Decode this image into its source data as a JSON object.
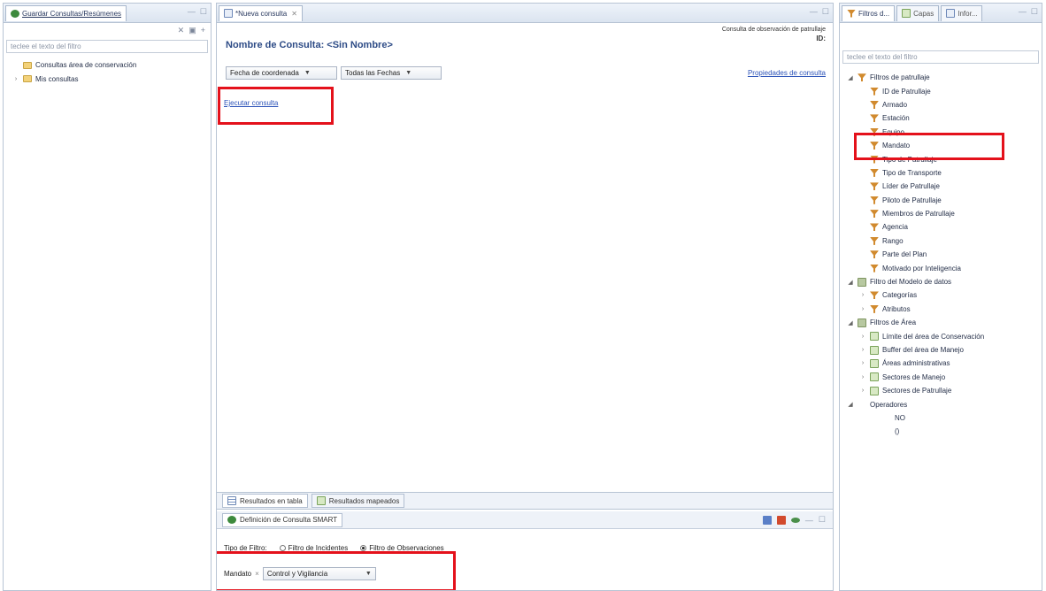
{
  "left_panel": {
    "tab_label": "Guardar Consultas/Resúmenes",
    "filter_placeholder": "teclee el texto del filtro",
    "tree": [
      {
        "label": "Consultas área de conservación",
        "expand": ""
      },
      {
        "label": "Mis consultas",
        "expand": "›"
      }
    ]
  },
  "editor": {
    "tab_label": "*Nueva consulta",
    "meta_line": "Consulta de observación de patrullaje",
    "meta_id": "ID:",
    "title": "Nombre de Consulta: <Sin Nombre>",
    "date_combo": "Fecha de coordenada",
    "range_combo": "Todas las Fechas",
    "properties_link": "Propiedades de consulta",
    "run_link": "Ejecutar consulta",
    "result_tabs": [
      "Resultados en tabla",
      "Resultados mapeados"
    ],
    "definition_tab": "Definición de Consulta SMART",
    "filter_type_label": "Tipo de Filtro:",
    "filter_types": [
      {
        "label": "Filtro de Incidentes",
        "selected": false
      },
      {
        "label": "Filtro de Observaciones",
        "selected": true
      }
    ],
    "chip_label": "Mandato",
    "chip_value": "Control y Vigilancia"
  },
  "right_panel": {
    "tabs": [
      "Filtros d...",
      "Capas",
      "Infor..."
    ],
    "filter_placeholder": "teclee el texto del filtro",
    "tree": [
      {
        "label": "Filtros de patrullaje",
        "level": 0,
        "expand": "◢",
        "icon": "filter"
      },
      {
        "label": "ID de Patrullaje",
        "level": 1,
        "expand": "",
        "icon": "filter"
      },
      {
        "label": "Armado",
        "level": 1,
        "expand": "",
        "icon": "filter"
      },
      {
        "label": "Estación",
        "level": 1,
        "expand": "",
        "icon": "filter"
      },
      {
        "label": "Equipo",
        "level": 1,
        "expand": "",
        "icon": "filter"
      },
      {
        "label": "Mandato",
        "level": 1,
        "expand": "",
        "icon": "filter"
      },
      {
        "label": "Tipo de Patrullaje",
        "level": 1,
        "expand": "",
        "icon": "filter"
      },
      {
        "label": "Tipo de Transporte",
        "level": 1,
        "expand": "",
        "icon": "filter"
      },
      {
        "label": "Líder de Patrullaje",
        "level": 1,
        "expand": "",
        "icon": "filter"
      },
      {
        "label": "Piloto de Patrullaje",
        "level": 1,
        "expand": "",
        "icon": "filter"
      },
      {
        "label": "Miembros de Patrullaje",
        "level": 1,
        "expand": "",
        "icon": "filter"
      },
      {
        "label": "Agencia",
        "level": 1,
        "expand": "",
        "icon": "filter"
      },
      {
        "label": "Rango",
        "level": 1,
        "expand": "",
        "icon": "filter"
      },
      {
        "label": "Parte del Plan",
        "level": 1,
        "expand": "",
        "icon": "filter"
      },
      {
        "label": "Motivado por Inteligencia",
        "level": 1,
        "expand": "",
        "icon": "filter"
      },
      {
        "label": "Filtro del Modelo de datos",
        "level": 0,
        "expand": "◢",
        "icon": "folder"
      },
      {
        "label": "Categorías",
        "level": 1,
        "expand": "›",
        "icon": "filter"
      },
      {
        "label": "Atributos",
        "level": 1,
        "expand": "›",
        "icon": "filter"
      },
      {
        "label": "Filtros de Área",
        "level": 0,
        "expand": "◢",
        "icon": "folder"
      },
      {
        "label": "Límite del área de Conservación",
        "level": 1,
        "expand": "›",
        "icon": "map"
      },
      {
        "label": "Buffer del área de Manejo",
        "level": 1,
        "expand": "›",
        "icon": "map"
      },
      {
        "label": "Áreas administrativas",
        "level": 1,
        "expand": "›",
        "icon": "map"
      },
      {
        "label": "Sectores de Manejo",
        "level": 1,
        "expand": "›",
        "icon": "map"
      },
      {
        "label": "Sectores de Patrullaje",
        "level": 1,
        "expand": "›",
        "icon": "map"
      },
      {
        "label": "Operadores",
        "level": 0,
        "expand": "◢",
        "icon": "none"
      },
      {
        "label": "NO",
        "level": 2,
        "expand": "",
        "icon": "none"
      },
      {
        "label": "()",
        "level": 2,
        "expand": "",
        "icon": "none"
      }
    ]
  }
}
